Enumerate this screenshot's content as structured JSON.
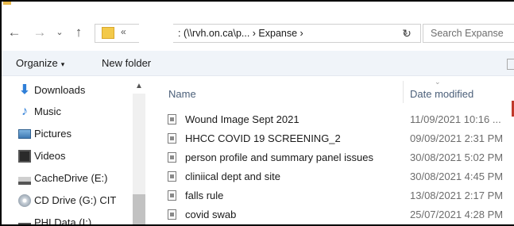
{
  "address_bar": {
    "breadcrumb_overflow": "«",
    "path": ": (\\\\rvh.on.ca\\p...  ›  Expanse  ›",
    "search_placeholder": "Search Expanse"
  },
  "nav": {
    "back": "←",
    "forward": "→",
    "recent": "⌄",
    "up": "↑",
    "dropdown": "⌄",
    "refresh": "↻"
  },
  "command_bar": {
    "organize": "Organize",
    "organize_dropdown": "▾",
    "new_folder": "New folder"
  },
  "sidebar": {
    "items": [
      {
        "label": "Downloads",
        "icon": "downloads-icon"
      },
      {
        "label": "Music",
        "icon": "music-icon"
      },
      {
        "label": "Pictures",
        "icon": "pictures-icon"
      },
      {
        "label": "Videos",
        "icon": "videos-icon"
      },
      {
        "label": "CacheDrive (E:)",
        "icon": "drive-icon"
      },
      {
        "label": "CD Drive (G:) CIT",
        "icon": "cd-drive-icon"
      },
      {
        "label": "PHI Data (I:)",
        "icon": "network-drive-icon"
      }
    ],
    "scroll_up": "▲"
  },
  "file_list": {
    "columns": {
      "name": "Name",
      "date_modified": "Date modified",
      "sort_indicator": "⌄"
    },
    "rows": [
      {
        "name": "Wound Image Sept 2021",
        "date_modified": "11/09/2021 10:16 ..."
      },
      {
        "name": "HHCC COVID 19 SCREENING_2",
        "date_modified": "09/09/2021 2:31 PM"
      },
      {
        "name": "person profile and summary panel issues",
        "date_modified": "30/08/2021 5:02 PM"
      },
      {
        "name": "cliniical dept and site",
        "date_modified": "30/08/2021 4:45 PM"
      },
      {
        "name": "falls rule",
        "date_modified": "13/08/2021 2:17 PM"
      },
      {
        "name": "covid swab",
        "date_modified": "25/07/2021 4:28 PM"
      }
    ]
  },
  "colors": {
    "accent_folder": "#f3c94a",
    "header_text": "#4c607a",
    "command_bar_bg": "#f0f4f9"
  }
}
